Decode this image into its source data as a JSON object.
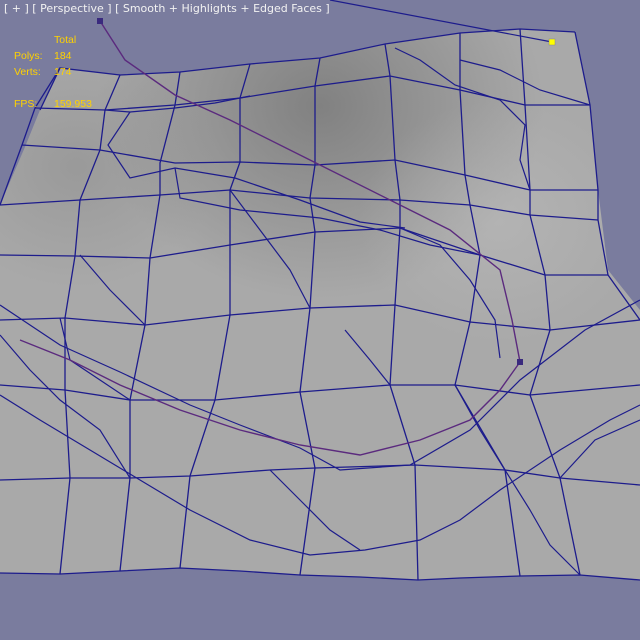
{
  "viewport": {
    "label": "[ + ] [ Perspective ] [ Smooth + Highlights + Edged Faces ]",
    "background_color": "#7a7c9e",
    "mesh_fill_color": "#a9a9a9",
    "wire_color": "#1d1c8c",
    "spline_color": "#5b2a7e",
    "selected_vertex_color": "#ffff00"
  },
  "stats": {
    "total_label": "Total",
    "polys_label": "Polys:",
    "polys_value": "184",
    "verts_label": "Verts:",
    "verts_value": "174",
    "fps_label": "FPS:",
    "fps_value": "159.953",
    "text_color": "#ffd200"
  }
}
